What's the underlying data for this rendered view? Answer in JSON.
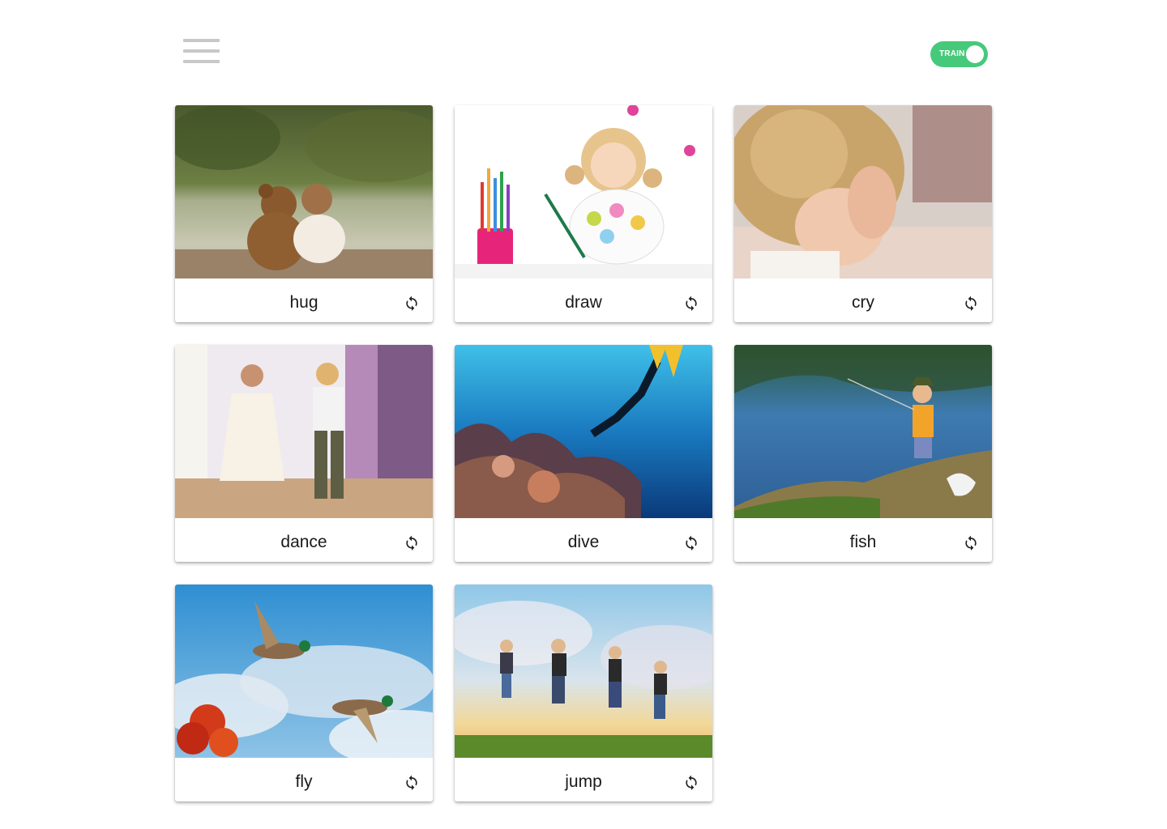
{
  "header": {
    "menu_icon": "hamburger-menu-icon",
    "toggle": {
      "label": "TRAIN",
      "on": true,
      "color": "#47c97b"
    }
  },
  "cards": [
    {
      "label": "hug",
      "image": "child hugging teddy bear by a lake",
      "action_icon": "refresh-icon"
    },
    {
      "label": "draw",
      "image": "girl drawing with colored pencils",
      "action_icon": "refresh-icon"
    },
    {
      "label": "cry",
      "image": "curly-haired child covering face",
      "action_icon": "refresh-icon"
    },
    {
      "label": "dance",
      "image": "two children dancing",
      "action_icon": "refresh-icon"
    },
    {
      "label": "dive",
      "image": "diver over coral reef",
      "action_icon": "refresh-icon"
    },
    {
      "label": "fish",
      "image": "boy fishing at a pond",
      "action_icon": "refresh-icon"
    },
    {
      "label": "fly",
      "image": "ducks flying in the sky",
      "action_icon": "refresh-icon"
    },
    {
      "label": "jump",
      "image": "kids jumping at sunset",
      "action_icon": "refresh-icon"
    }
  ]
}
